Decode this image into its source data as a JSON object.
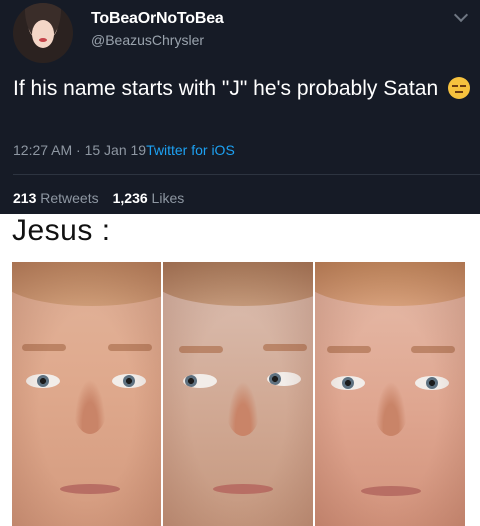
{
  "tweet": {
    "display_name": "ToBeaOrNoToBea",
    "handle": "@BeazusChrysler",
    "text": "If his name starts with \"J\" he's probably Satan",
    "emoji": "unamused-face-emoji",
    "time": "12:27 AM · 15 Jan 19",
    "client": "Twitter for iOS",
    "retweets_count": "213",
    "retweets_label": "Retweets",
    "likes_count": "1,236",
    "likes_label": "Likes",
    "colors": {
      "background": "#161b26",
      "link": "#1da1f2",
      "muted": "#8e97a2"
    }
  },
  "meme": {
    "caption": "Jesus :",
    "panels": [
      "face-looking-straight",
      "face-glancing-sideways",
      "face-looking-straight-reddened"
    ]
  }
}
